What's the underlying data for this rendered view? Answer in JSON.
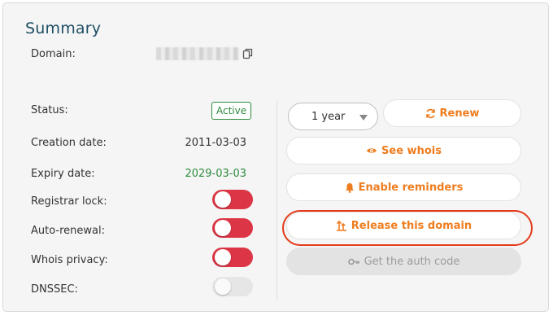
{
  "summary": {
    "title": "Summary",
    "domain_label": "Domain:",
    "status_label": "Status:",
    "status_value": "Active",
    "creation_label": "Creation date:",
    "creation_value": "2011-03-03",
    "expiry_label": "Expiry date:",
    "expiry_value": "2029-03-03",
    "registrar_lock_label": "Registrar lock:",
    "registrar_lock_on": true,
    "auto_renewal_label": "Auto-renewal:",
    "auto_renewal_on": true,
    "whois_privacy_label": "Whois privacy:",
    "whois_privacy_on": true,
    "dnssec_label": "DNSSEC:",
    "dnssec_on": false
  },
  "actions": {
    "period_select": "1 year",
    "renew": "Renew",
    "see_whois": "See whois",
    "enable_reminders": "Enable reminders",
    "release_domain": "Release this domain",
    "auth_code": "Get the auth code"
  },
  "colors": {
    "accent": "#ee7d1f",
    "title": "#1d4e63",
    "active_green": "#2e8b3e",
    "toggle_on": "#dc3545",
    "highlight_ring": "#e43a1c"
  }
}
